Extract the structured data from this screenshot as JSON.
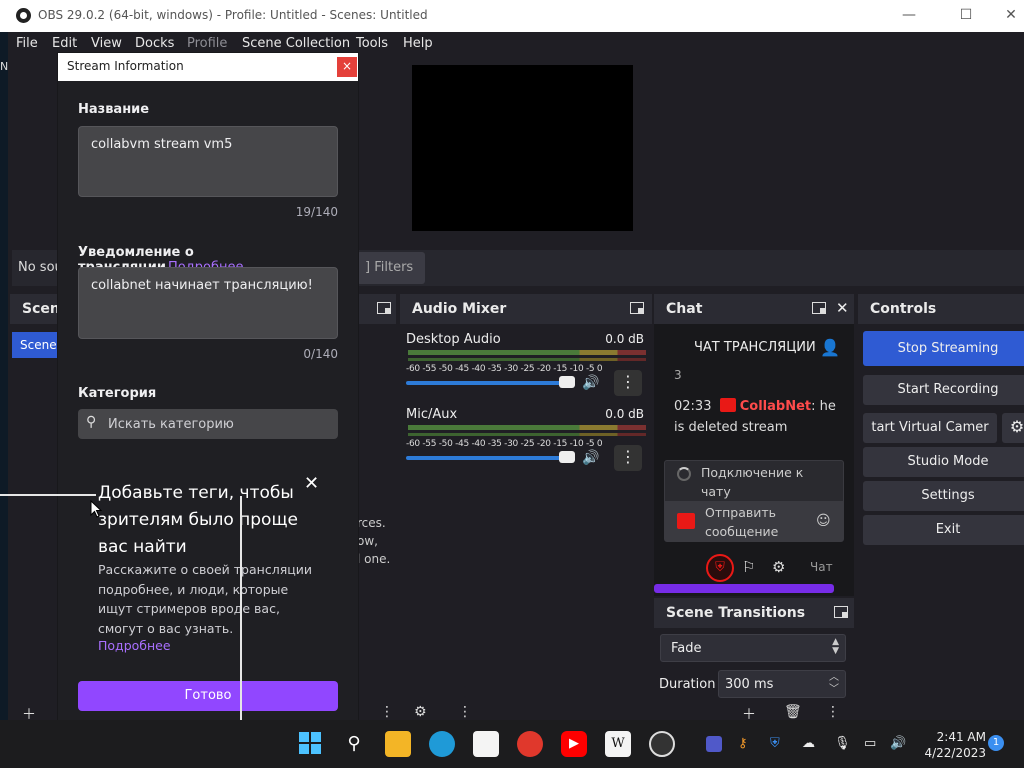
{
  "window": {
    "title": "OBS 29.0.2 (64-bit, windows) - Profile: Untitled - Scenes: Untitled",
    "minimize": "—",
    "maximize": "☐",
    "close": "✕"
  },
  "menu": [
    "File",
    "Edit",
    "View",
    "Docks",
    "Profile",
    "Scene Collection",
    "Tools",
    "Help"
  ],
  "main": {
    "left_edge_char": "N",
    "no_source_text": "No sou",
    "filters_label": "Filters",
    "scenes_title": "Scene",
    "scene_item": "Scene",
    "sources_help": [
      "rces.",
      "ow,",
      "l one."
    ]
  },
  "audio_mixer": {
    "title": "Audio Mixer",
    "scale": "-60 -55 -50 -45 -40 -35 -30 -25 -20 -15 -10 -5 0",
    "channels": [
      {
        "name": "Desktop Audio",
        "db": "0.0 dB"
      },
      {
        "name": "Mic/Aux",
        "db": "0.0 dB"
      }
    ]
  },
  "chat": {
    "title": "Chat",
    "header": "ЧАТ ТРАНСЛЯЦИИ",
    "stub_char": "3",
    "message_time": "02:33",
    "message_user": "CollabNet",
    "message_text": ": he is deleted stream",
    "popup_connecting": "Подключение к чату",
    "popup_send": "Отправить сообщение",
    "bottom_label": "Чат"
  },
  "controls": {
    "title": "Controls",
    "buttons": [
      "Stop Streaming",
      "Start Recording",
      "tart Virtual Camer",
      "Studio Mode",
      "Settings",
      "Exit"
    ]
  },
  "transitions": {
    "title": "Scene Transitions",
    "selected": "Fade",
    "duration_label": "Duration",
    "duration_value": "300 ms"
  },
  "stream_info": {
    "title": "Stream Information",
    "title_label": "Название",
    "title_value": "collabvm stream vm5",
    "title_counter": "19/140",
    "notif_label": "Уведомление о трансляции",
    "notif_link": "Подробнее",
    "notif_value": "collabnet начинает трансляцию!",
    "notif_counter": "0/140",
    "category_label": "Категория",
    "category_placeholder": "Искать категорию",
    "popover_title": "Добавьте теги, чтобы зрителям было проще вас найти",
    "popover_text": "Расскажите о своей трансляции подробнее, и люди, которые ищут стримеров вроде вас, смогут о вас узнать.",
    "popover_link": "Подробнее",
    "done_button": "Готово"
  },
  "taskbar": {
    "time": "2:41 AM",
    "date": "4/22/2023",
    "notification_count": "1",
    "wiki_letter": "W"
  },
  "colors": {
    "accent_purple": "#9147ff",
    "obs_blue": "#2f5bd3",
    "twitch_red": "#e91916"
  }
}
